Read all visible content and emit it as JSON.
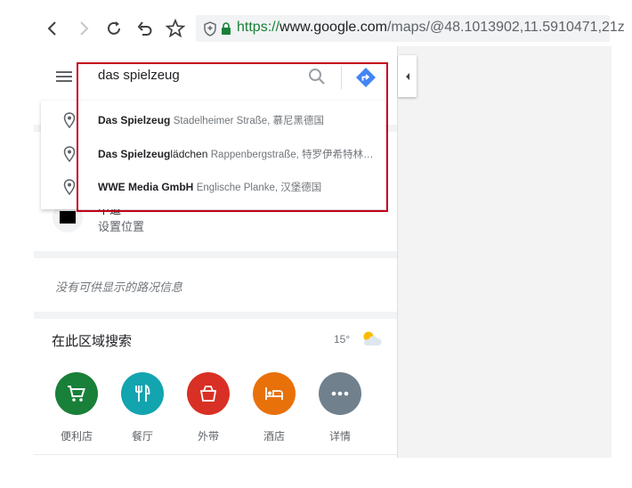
{
  "browser": {
    "url_scheme": "https://",
    "url_host": "www.google.com",
    "url_path": "/maps/@48.1013902,11.5910471,21z"
  },
  "search": {
    "query": "das spielzeug"
  },
  "suggestions": [
    {
      "bold": "Das Spielzeug",
      "rest": "",
      "detail": "Stadelheimer Straße, 慕尼黑德国"
    },
    {
      "bold": "Das Spielzeug",
      "rest": "lädchen",
      "detail": "Rappenbergstraße, 特罗伊希特林…"
    },
    {
      "bold": "WWE Media GmbH",
      "rest": "",
      "detail": "Englische Planke, 汉堡德国"
    }
  ],
  "location": {
    "title_partial": "中道",
    "label": "设置位置"
  },
  "traffic": {
    "message": "没有可供显示的路况信息"
  },
  "area_search": {
    "title": "在此区域搜索",
    "temperature": "15°",
    "weather_icon": "partly-cloudy-icon",
    "categories": [
      {
        "label": "便利店",
        "icon": "shopping-cart-icon",
        "color": "#188038"
      },
      {
        "label": "餐厅",
        "icon": "restaurant-icon",
        "color": "#12a4af"
      },
      {
        "label": "外带",
        "icon": "takeout-icon",
        "color": "#d93025"
      },
      {
        "label": "酒店",
        "icon": "hotel-icon",
        "color": "#e8710a"
      },
      {
        "label": "详情",
        "icon": "more-icon",
        "color": "#70808d"
      }
    ]
  },
  "colors": {
    "highlight_frame": "#c40018",
    "directions": "#4285f4"
  }
}
